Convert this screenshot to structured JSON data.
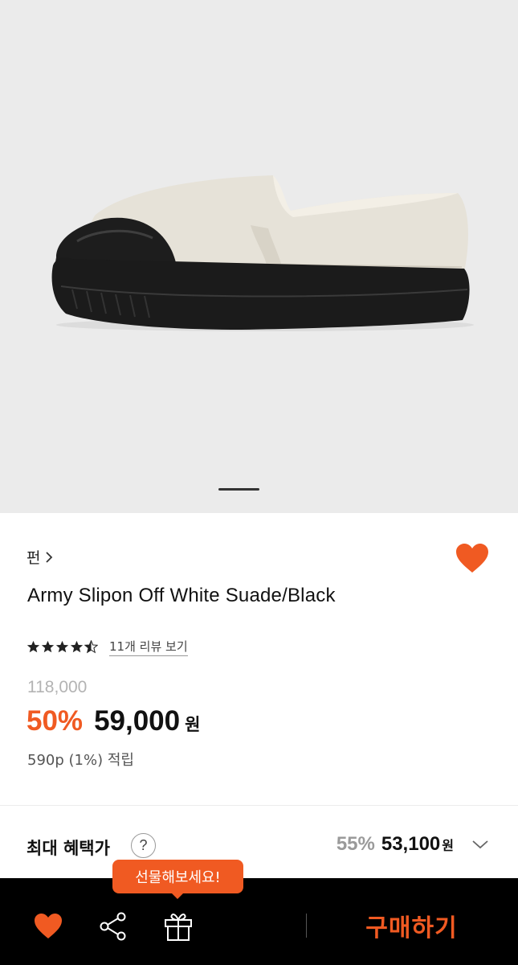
{
  "product": {
    "brand": "펀",
    "title": "Army Slipon Off White Suade/Black",
    "rating": 4.5,
    "review_link": "11개 리뷰 보기",
    "original_price": "118,000",
    "discount": "50%",
    "price": "59,000",
    "currency": "원",
    "points": "590p (1%) 적립",
    "image_count_indicator": "1"
  },
  "benefit": {
    "label": "최대 혜택가",
    "help": "?",
    "rate": "55%",
    "price": "53,100",
    "currency": "원"
  },
  "tooltip": {
    "text": "선물해보세요!"
  },
  "bottom_bar": {
    "buy_label": "구매하기",
    "icons": [
      "heart-icon",
      "share-icon",
      "gift-icon"
    ]
  },
  "colors": {
    "accent": "#f05a22",
    "hero_bg": "#ebebeb",
    "bar_bg": "#000000"
  }
}
